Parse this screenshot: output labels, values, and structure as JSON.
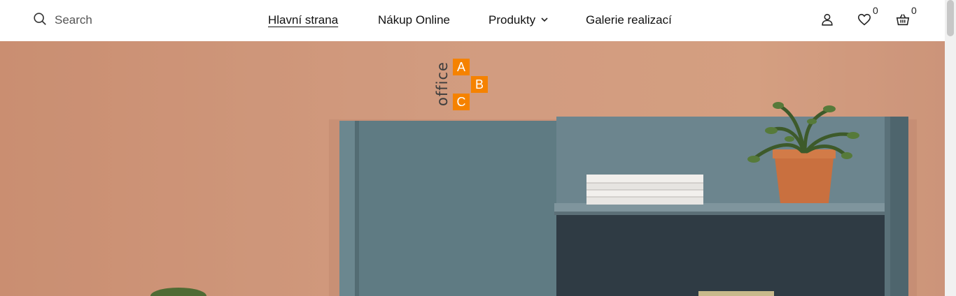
{
  "search": {
    "placeholder": "Search",
    "icon": "search-icon"
  },
  "nav": {
    "items": [
      {
        "label": "Hlavní strana",
        "active": true
      },
      {
        "label": "Nákup Online"
      },
      {
        "label": "Produkty",
        "has_dropdown": true
      },
      {
        "label": "Galerie realizací"
      }
    ]
  },
  "actions": {
    "account_icon": "user-icon",
    "wishlist": {
      "icon": "heart-icon",
      "count": "0"
    },
    "cart": {
      "icon": "basket-icon",
      "count": "0"
    }
  },
  "logo": {
    "word": "office",
    "letters": [
      "A",
      "B",
      "C"
    ],
    "accent_color": "#f58200"
  },
  "hero": {
    "wall_color": "#d09a7e",
    "shelf_color": "#5e7881"
  }
}
